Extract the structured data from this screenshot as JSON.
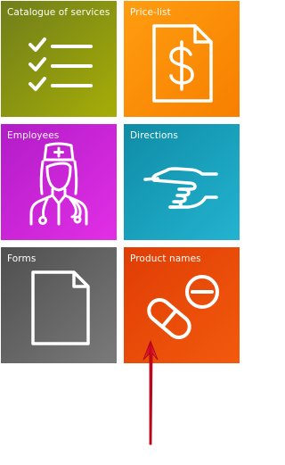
{
  "tiles": {
    "catalogue": {
      "label": "Catalogue of services",
      "icon": "checklist-icon",
      "color": "#8c9510"
    },
    "price": {
      "label": "Price-list",
      "icon": "dollar-document-icon",
      "color": "#fb8e08"
    },
    "employees": {
      "label": "Employees",
      "icon": "nurse-icon",
      "color": "#c825d6"
    },
    "directions": {
      "label": "Directions",
      "icon": "pointing-hand-icon",
      "color": "#17a0bc"
    },
    "forms": {
      "label": "Forms",
      "icon": "document-icon",
      "color": "#666666"
    },
    "product": {
      "label": "Product names",
      "icon": "pills-icon",
      "color": "#e9490a"
    }
  },
  "annotation": {
    "arrow_color": "#d0021b"
  }
}
